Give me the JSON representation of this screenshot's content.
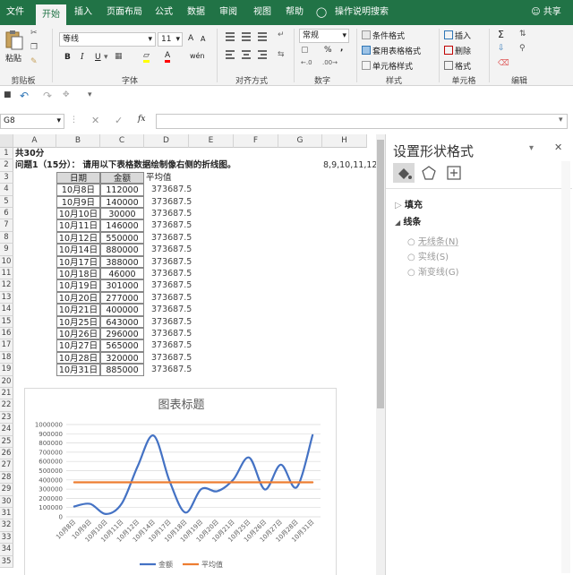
{
  "tabs": [
    "文件",
    "开始",
    "插入",
    "页面布局",
    "公式",
    "数据",
    "审阅",
    "视图",
    "帮助",
    "操作说明搜索"
  ],
  "share_label": "共享",
  "ribbon": {
    "paste": "粘贴",
    "font_name": "等线",
    "font_size": "11",
    "bold": "B",
    "italic": "I",
    "underline": "U",
    "grow_font": "A",
    "shrink_font": "A",
    "font_color_letter": "A",
    "wen": "wén",
    "number_format": "常规",
    "percent": "%",
    "comma": ",",
    "conditional_format": "条件格式",
    "table_format": "套用表格格式",
    "cell_style": "单元格样式",
    "insert": "插入",
    "delete": "删除",
    "format": "格式",
    "groups": [
      "剪贴板",
      "字体",
      "对齐方式",
      "数字",
      "样式",
      "单元格",
      "编辑"
    ]
  },
  "formula_bar": {
    "name_box": "G8",
    "fx": "fx",
    "formula": ""
  },
  "columns": [
    "A",
    "B",
    "C",
    "D",
    "E",
    "F",
    "G",
    "H"
  ],
  "rows": [
    "1",
    "2",
    "3",
    "4",
    "5",
    "6",
    "7",
    "8",
    "9",
    "10",
    "11",
    "12",
    "13",
    "14",
    "15",
    "16",
    "17",
    "18",
    "19",
    "20",
    "21",
    "22",
    "23",
    "24",
    "25",
    "26",
    "27",
    "28",
    "29",
    "30",
    "31",
    "32",
    "33",
    "34",
    "35"
  ],
  "sheet": {
    "a1": "共30分",
    "a2": "问题1（15分）：  请用以下表格数据绘制像右侧的折线图。",
    "h2": "8,9,10,11,12,",
    "header_date": "日期",
    "header_amount": "金额",
    "header_avg": "平均值",
    "table": [
      {
        "date": "10月8日",
        "amount": "112000",
        "avg": "373687.5"
      },
      {
        "date": "10月9日",
        "amount": "140000",
        "avg": "373687.5"
      },
      {
        "date": "10月10日",
        "amount": "30000",
        "avg": "373687.5"
      },
      {
        "date": "10月11日",
        "amount": "146000",
        "avg": "373687.5"
      },
      {
        "date": "10月12日",
        "amount": "550000",
        "avg": "373687.5"
      },
      {
        "date": "10月14日",
        "amount": "880000",
        "avg": "373687.5"
      },
      {
        "date": "10月17日",
        "amount": "388000",
        "avg": "373687.5"
      },
      {
        "date": "10月18日",
        "amount": "46000",
        "avg": "373687.5"
      },
      {
        "date": "10月19日",
        "amount": "301000",
        "avg": "373687.5"
      },
      {
        "date": "10月20日",
        "amount": "277000",
        "avg": "373687.5"
      },
      {
        "date": "10月21日",
        "amount": "400000",
        "avg": "373687.5"
      },
      {
        "date": "10月25日",
        "amount": "643000",
        "avg": "373687.5"
      },
      {
        "date": "10月26日",
        "amount": "296000",
        "avg": "373687.5"
      },
      {
        "date": "10月27日",
        "amount": "565000",
        "avg": "373687.5"
      },
      {
        "date": "10月28日",
        "amount": "320000",
        "avg": "373687.5"
      },
      {
        "date": "10月31日",
        "amount": "885000",
        "avg": "373687.5"
      }
    ]
  },
  "chart_data": {
    "type": "line",
    "title": "图表标题",
    "categories": [
      "10月8日",
      "10月9日",
      "10月10日",
      "10月11日",
      "10月12日",
      "10月14日",
      "10月17日",
      "10月18日",
      "10月19日",
      "10月20日",
      "10月21日",
      "10月25日",
      "10月26日",
      "10月27日",
      "10月28日",
      "10月31日"
    ],
    "series": [
      {
        "name": "金额",
        "color": "#4472c4",
        "values": [
          112000,
          140000,
          30000,
          146000,
          550000,
          880000,
          388000,
          46000,
          301000,
          277000,
          400000,
          643000,
          296000,
          565000,
          320000,
          885000
        ]
      },
      {
        "name": "平均值",
        "color": "#ed7d31",
        "values": [
          373687.5,
          373687.5,
          373687.5,
          373687.5,
          373687.5,
          373687.5,
          373687.5,
          373687.5,
          373687.5,
          373687.5,
          373687.5,
          373687.5,
          373687.5,
          373687.5,
          373687.5,
          373687.5
        ]
      }
    ],
    "ylim": [
      0,
      1000000
    ],
    "yticks": [
      "1000000",
      "900000",
      "800000",
      "700000",
      "600000",
      "500000",
      "400000",
      "300000",
      "200000",
      "100000",
      "0"
    ],
    "legend": "bottom",
    "smooth": true
  },
  "panel": {
    "title": "设置形状格式",
    "fill": "填充",
    "line": "线条",
    "options": [
      "无线条(N)",
      "实线(S)",
      "渐变线(G)"
    ]
  }
}
